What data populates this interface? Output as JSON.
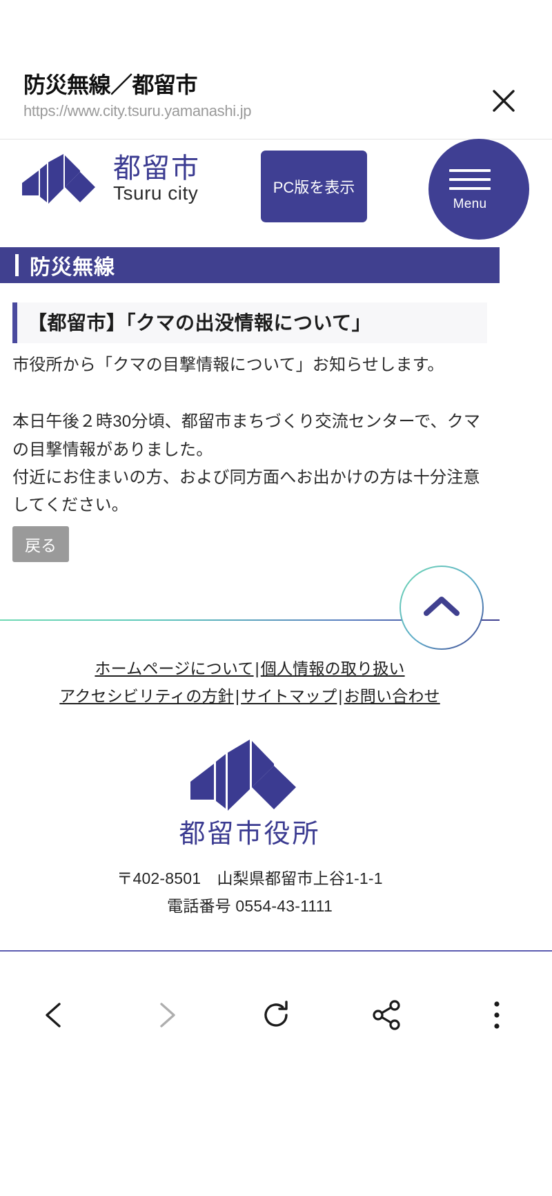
{
  "browser": {
    "title": "防災無線／都留市",
    "url": "https://www.city.tsuru.yamanashi.jp",
    "close_icon": "close-icon"
  },
  "site_header": {
    "logo_ja": "都留市",
    "logo_en": "Tsuru city",
    "pc_view_button": "PC版を表示",
    "menu_label": "Menu",
    "menu_icon": "hamburger-icon"
  },
  "section": {
    "title": "防災無線"
  },
  "article": {
    "heading": "【都留市】「クマの出没情報について」",
    "paragraph_1": "市役所から「クマの目撃情報について」お知らせします。",
    "paragraph_2_line_1": "本日午後２時30分頃、都留市まちづくり交流センターで、クマの目撃情報がありました。",
    "paragraph_2_line_2": "付近にお住まいの方、および同方面へお出かけの方は十分注意してください。",
    "back_button": "戻る"
  },
  "to_top": {
    "icon": "chevron-up-icon"
  },
  "footer": {
    "links_row1": [
      {
        "label": "ホームページについて"
      },
      {
        "label": "個人情報の取り扱い"
      }
    ],
    "links_row2": [
      {
        "label": "アクセシビリティの方針"
      },
      {
        "label": "サイトマップ"
      },
      {
        "label": "お問い合わせ"
      }
    ],
    "separator": "|",
    "logo_text": "都留市役所",
    "address": "〒402-8501　山梨県都留市上谷1-1-1",
    "phone": "電話番号 0554-43-1111"
  },
  "bottom_nav": {
    "back": {
      "icon": "chevron-left-icon"
    },
    "forward": {
      "icon": "chevron-right-icon"
    },
    "reload": {
      "icon": "reload-icon"
    },
    "share": {
      "icon": "share-icon"
    },
    "more": {
      "icon": "more-vertical-icon"
    }
  },
  "colors": {
    "brand_purple": "#3f3f93",
    "section_bar": "#40408f",
    "accent_teal": "#6fd9b3",
    "muted_gray": "#9a9a9a",
    "url_gray": "#9a9a9a"
  }
}
